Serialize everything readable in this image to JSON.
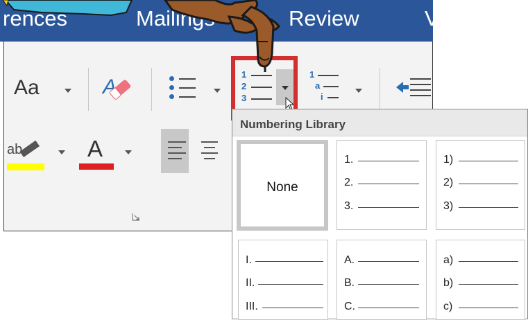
{
  "ribbon_tabs": {
    "references": "rences",
    "mailings": "Mailings",
    "review": "Review",
    "view": "V"
  },
  "font_group": {
    "change_case_label": "Aa",
    "highlight_color": "#ffff00",
    "font_color": "#e02020",
    "font_color_letter": "A"
  },
  "numbering_library": {
    "header": "Numbering Library",
    "tiles": [
      {
        "kind": "none",
        "label": "None",
        "selected": true
      },
      {
        "kind": "list",
        "items": [
          "1.",
          "2.",
          "3."
        ]
      },
      {
        "kind": "list",
        "items": [
          "1)",
          "2)",
          "3)"
        ]
      },
      {
        "kind": "list",
        "items": [
          "I.",
          "II.",
          "III."
        ]
      },
      {
        "kind": "list",
        "items": [
          "A.",
          "B.",
          "C."
        ]
      },
      {
        "kind": "list",
        "items": [
          "a)",
          "b)",
          "c)"
        ]
      }
    ]
  },
  "numbering_button": {
    "glyphs": [
      "1",
      "2",
      "3"
    ]
  },
  "multilevel_button": {
    "glyphs": [
      "1",
      "a",
      "i"
    ]
  },
  "colors": {
    "tab_bar": "#2b579a",
    "highlight_box": "#d32f2f",
    "icon_blue": "#2b6cb0"
  }
}
